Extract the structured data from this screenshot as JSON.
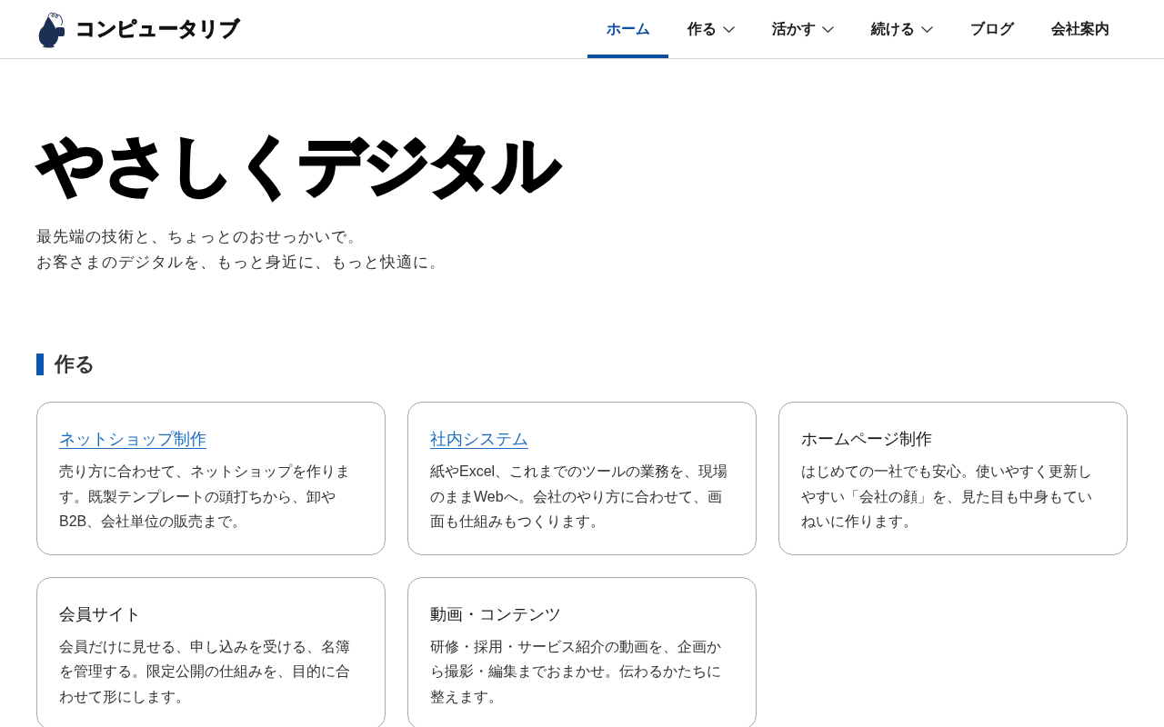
{
  "header": {
    "logo": {
      "text": "コンピュータリブ"
    },
    "nav": [
      {
        "label": "ホーム",
        "selected": true,
        "has_dropdown": false
      },
      {
        "label": "作る",
        "selected": false,
        "has_dropdown": true
      },
      {
        "label": "活かす",
        "selected": false,
        "has_dropdown": true
      },
      {
        "label": "続ける",
        "selected": false,
        "has_dropdown": true
      },
      {
        "label": "ブログ",
        "selected": false,
        "has_dropdown": false
      },
      {
        "label": "会社案内",
        "selected": false,
        "has_dropdown": false
      }
    ]
  },
  "hero": {
    "title": "やさしくデジタル",
    "tagline": [
      "最先端の技術と、ちょっとのおせっかいで。",
      "お客さまのデジタルを、もっと身近に、もっと快適に。"
    ]
  },
  "sections": [
    {
      "heading": "作る",
      "cards": [
        {
          "kind": "link",
          "title": "ネットショップ制作",
          "description": "売り方に合わせて、ネットショップを作ります。既製テンプレートの頭打ちから、卸やB2B、会社単位の販売まで。"
        },
        {
          "kind": "link",
          "title": "社内システム",
          "description": "紙やExcel、これまでのツールの業務を、現場のままWebへ。会社のやり方に合わせて、画面も仕組みもつくります。"
        },
        {
          "kind": "text",
          "title": "ホームページ制作",
          "description": "はじめての一社でも安心。使いやすく更新しやすい「会社の顔」を、見た目も中身もていねいに作ります。"
        },
        {
          "kind": "text",
          "title": "会員サイト",
          "description": "会員だけに見せる、申し込みを受ける、名簿を管理する。限定公開の仕組みを、目的に合わせて形にします。"
        },
        {
          "kind": "text",
          "title": "動画・コンテンツ",
          "description": "研修・採用・サービス紹介の動画を、企画から撮影・編集までおまかせ。伝わるかたちに整えます。"
        }
      ]
    }
  ]
}
